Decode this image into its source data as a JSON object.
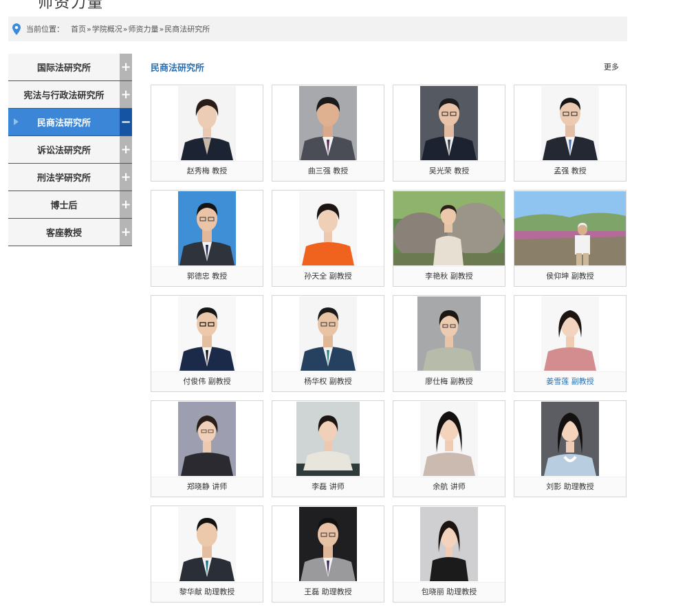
{
  "page_title": "师资力量",
  "breadcrumb": {
    "label": "当前位置：",
    "items": [
      "首页",
      "学院概况",
      "师资力量",
      "民商法研究所"
    ],
    "separator": "»"
  },
  "sidebar": {
    "items": [
      {
        "label": "国际法研究所",
        "toggle": "+"
      },
      {
        "label": "宪法与行政法研究所",
        "toggle": "+"
      },
      {
        "label": "民商法研究所",
        "toggle": "−"
      },
      {
        "label": "诉讼法研究所",
        "toggle": "+"
      },
      {
        "label": "刑法学研究所",
        "toggle": "+"
      },
      {
        "label": "博士后",
        "toggle": "+"
      },
      {
        "label": "客座教授",
        "toggle": "+"
      }
    ]
  },
  "section": {
    "title": "民商法研究所",
    "more": "更多"
  },
  "faculty": [
    {
      "name": "赵秀梅 教授"
    },
    {
      "name": "曲三强 教授"
    },
    {
      "name": "吴光荣 教授"
    },
    {
      "name": "孟强 教授"
    },
    {
      "name": "郭德忠 教授"
    },
    {
      "name": "孙天全 副教授"
    },
    {
      "name": "李艳秋 副教授"
    },
    {
      "name": "侯仰坤 副教授"
    },
    {
      "name": "付俊伟 副教授"
    },
    {
      "name": "杨华权 副教授"
    },
    {
      "name": "廖仕梅 副教授"
    },
    {
      "name": "姜雪莲 副教授"
    },
    {
      "name": "郑晓静 讲师"
    },
    {
      "name": "李磊 讲师"
    },
    {
      "name": "余航 讲师"
    },
    {
      "name": "刘影 助理教授"
    },
    {
      "name": "黎华献 助理教授"
    },
    {
      "name": "王磊 助理教授"
    },
    {
      "name": "包晓丽 助理教授"
    }
  ],
  "colors": {
    "accent_blue": "#2a6fb1",
    "active_item": "#3b86d6",
    "active_toggle": "#1553a3",
    "toggle_gray": "#b5b5b5"
  }
}
